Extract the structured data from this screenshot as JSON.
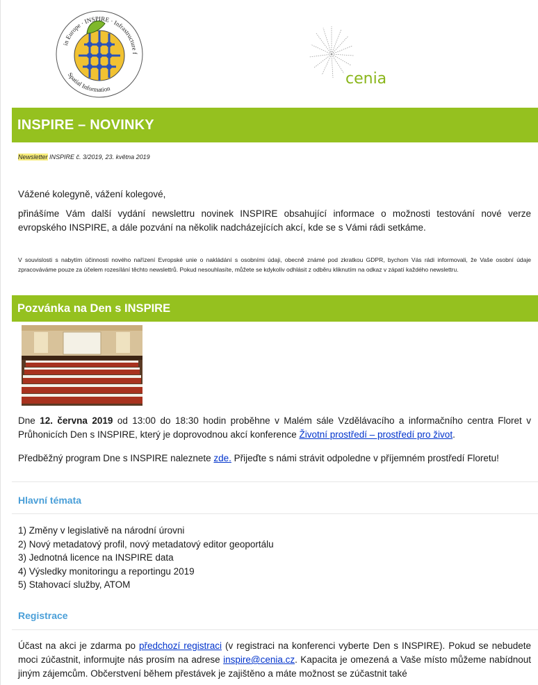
{
  "logos": {
    "inspire_logo_text": "INSPIRE - Infrastructure for Spatial Information in Europe",
    "cenia_text": "cenia"
  },
  "header": {
    "title": "INSPIRE – NOVINKY"
  },
  "issue": {
    "label": "Newsletter",
    "rest": " INSPIRE č. 3/2019, 23. května 2019"
  },
  "greeting": "Vážené kolegyně, vážení kolegové,",
  "intro": "přinášíme Vám další vydání newslettru novinek INSPIRE obsahující informace o možnosti testování nové verze evropského INSPIRE, a dále pozvání na několik nadcházejících akcí, kde se s Vámi rádi setkáme.",
  "gdpr_note": "V souvislosti s nabytím účinnosti nového nařízení Evropské unie o nakládání s osobními údaji, obecně známé pod zkratkou GDPR, bychom Vás rádi informovali, že Vaše osobní údaje zpracováváme pouze za účelem rozesílání těchto newslettrů. Pokud nesouhlasíte, můžete se kdykoliv odhlásit z odběru kliknutím na odkaz v zápatí každého newslettru.",
  "section": {
    "title": "Pozvánka na Den s INSPIRE",
    "p1_pre": "Dne ",
    "p1_date": "12. června 2019",
    "p1_mid": " od 13:00 do 18:30 hodin proběhne v Malém sále Vzdělávacího a informačního centra Floret v Průhonicích Den s INSPIRE, který je doprovodnou akcí konference ",
    "p1_link": "Životní prostředí – prostředí pro život",
    "p1_end": ".",
    "p2_pre": "Předběžný program Dne s INSPIRE naleznete ",
    "p2_link": "zde.",
    "p2_end": " Přijeďte s námi strávit odpoledne v příjemném prostředí Floretu!"
  },
  "topics": {
    "heading": "Hlavní témata",
    "items": [
      "1) Změny v legislativě na národní úrovni",
      "2) Nový metadatový profil, nový metadatový editor geoportálu",
      "3) Jednotná licence na INSPIRE data",
      "4) Výsledky monitoringu a reportingu 2019",
      "5) Stahovací služby, ATOM"
    ]
  },
  "registration": {
    "heading": "Registrace",
    "pre": "Účast na akci je zdarma po ",
    "link1": "předchozí registraci",
    "mid1": " (v registraci na konferenci vyberte Den s INSPIRE). Pokud se nebudete moci zúčastnit, informujte nás prosím na adrese ",
    "email": "inspire@cenia.cz",
    "mid2": ". Kapacita je omezená a Vaše místo můžeme nabídnout jiným zájemcům. Občerstvení během přestávek je zajištěno a máte možnost se zúčastnit také"
  }
}
